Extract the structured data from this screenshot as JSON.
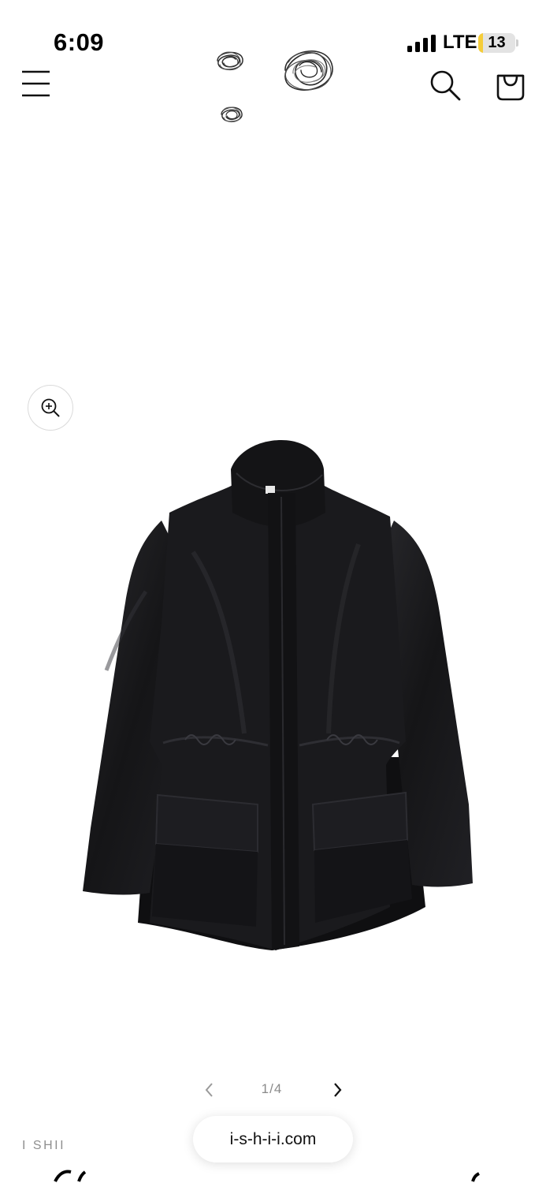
{
  "status_bar": {
    "time": "6:09",
    "carrier": "LTE",
    "battery_level": "13",
    "battery_fill_fraction": 0.13,
    "signal_bars_filled": 4
  },
  "header": {
    "menu_icon": "hamburger-menu-icon",
    "logo": "scribble-circles-logo",
    "search_icon": "search-icon",
    "cart_icon": "shopping-bag-icon"
  },
  "gallery": {
    "zoom_icon": "zoom-in-icon",
    "image": "black-nylon-drawstring-jacket",
    "current_slide": "1/4",
    "prev_icon": "chevron-left-icon",
    "next_icon": "chevron-right-icon"
  },
  "product": {
    "vendor": "I SHII"
  },
  "browser": {
    "url": "i-s-h-i-i.com"
  },
  "colors": {
    "background": "#ffffff",
    "text": "#111111",
    "muted": "#8a8a8a",
    "battery_low": "#f5cd3a",
    "jacket": "#17171a"
  }
}
